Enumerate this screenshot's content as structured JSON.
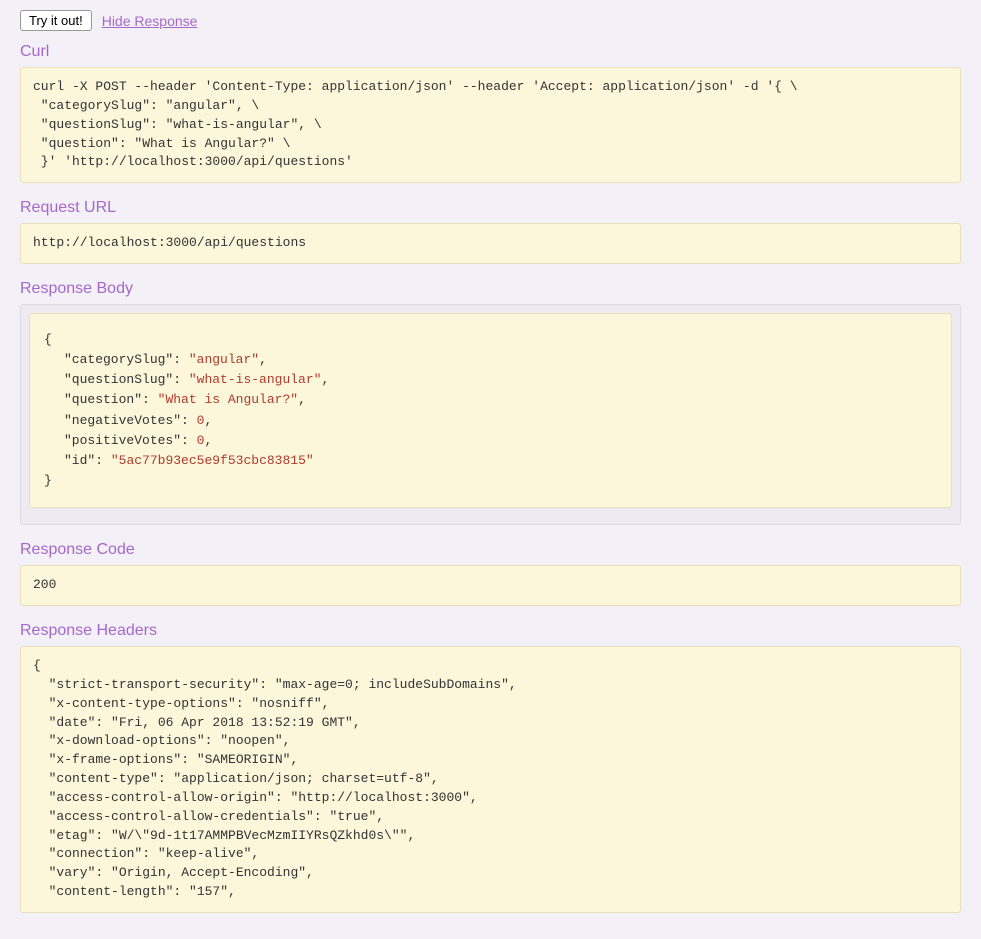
{
  "toolbar": {
    "tryButton": "Try it out!",
    "hideLink": "Hide Response"
  },
  "sections": {
    "curl": {
      "title": "Curl",
      "content": "curl -X POST --header 'Content-Type: application/json' --header 'Accept: application/json' -d '{ \\ \n \"categorySlug\": \"angular\", \\ \n \"questionSlug\": \"what-is-angular\", \\ \n \"question\": \"What is Angular?\" \\ \n }' 'http://localhost:3000/api/questions'"
    },
    "requestUrl": {
      "title": "Request URL",
      "content": "http://localhost:3000/api/questions"
    },
    "responseBody": {
      "title": "Response Body",
      "json": {
        "categorySlug": "angular",
        "questionSlug": "what-is-angular",
        "question": "What is Angular?",
        "negativeVotes": 0,
        "positiveVotes": 0,
        "id": "5ac77b93ec5e9f53cbc83815"
      }
    },
    "responseCode": {
      "title": "Response Code",
      "content": "200"
    },
    "responseHeaders": {
      "title": "Response Headers",
      "content": "{\n  \"strict-transport-security\": \"max-age=0; includeSubDomains\",\n  \"x-content-type-options\": \"nosniff\",\n  \"date\": \"Fri, 06 Apr 2018 13:52:19 GMT\",\n  \"x-download-options\": \"noopen\",\n  \"x-frame-options\": \"SAMEORIGIN\",\n  \"content-type\": \"application/json; charset=utf-8\",\n  \"access-control-allow-origin\": \"http://localhost:3000\",\n  \"access-control-allow-credentials\": \"true\",\n  \"etag\": \"W/\\\"9d-1t17AMMPBVecMzmIIYRsQZkhd0s\\\"\",\n  \"connection\": \"keep-alive\",\n  \"vary\": \"Origin, Accept-Encoding\",\n  \"content-length\": \"157\","
    }
  }
}
